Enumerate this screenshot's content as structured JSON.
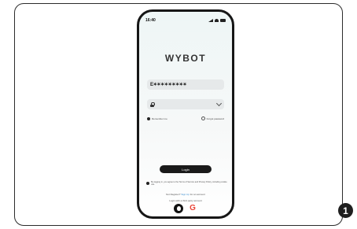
{
  "step": {
    "number": "1"
  },
  "status_bar": {
    "time": "16:40"
  },
  "app": {
    "logo": "WYBOT"
  },
  "login": {
    "email_value": "E✶✶✶✶✶✶✶✶✶",
    "remember_me": "Remember me",
    "forgot_password": "Forgot password",
    "login_button": "Login",
    "terms_text": "By logging in, you agree to the Terms of Service and Privacy Policy, including cookie use.",
    "signup_prefix": "Not Register?",
    "signup_link": "Sign Up",
    "signup_suffix": "for an account",
    "third_party_text": "Login with a third party account"
  }
}
